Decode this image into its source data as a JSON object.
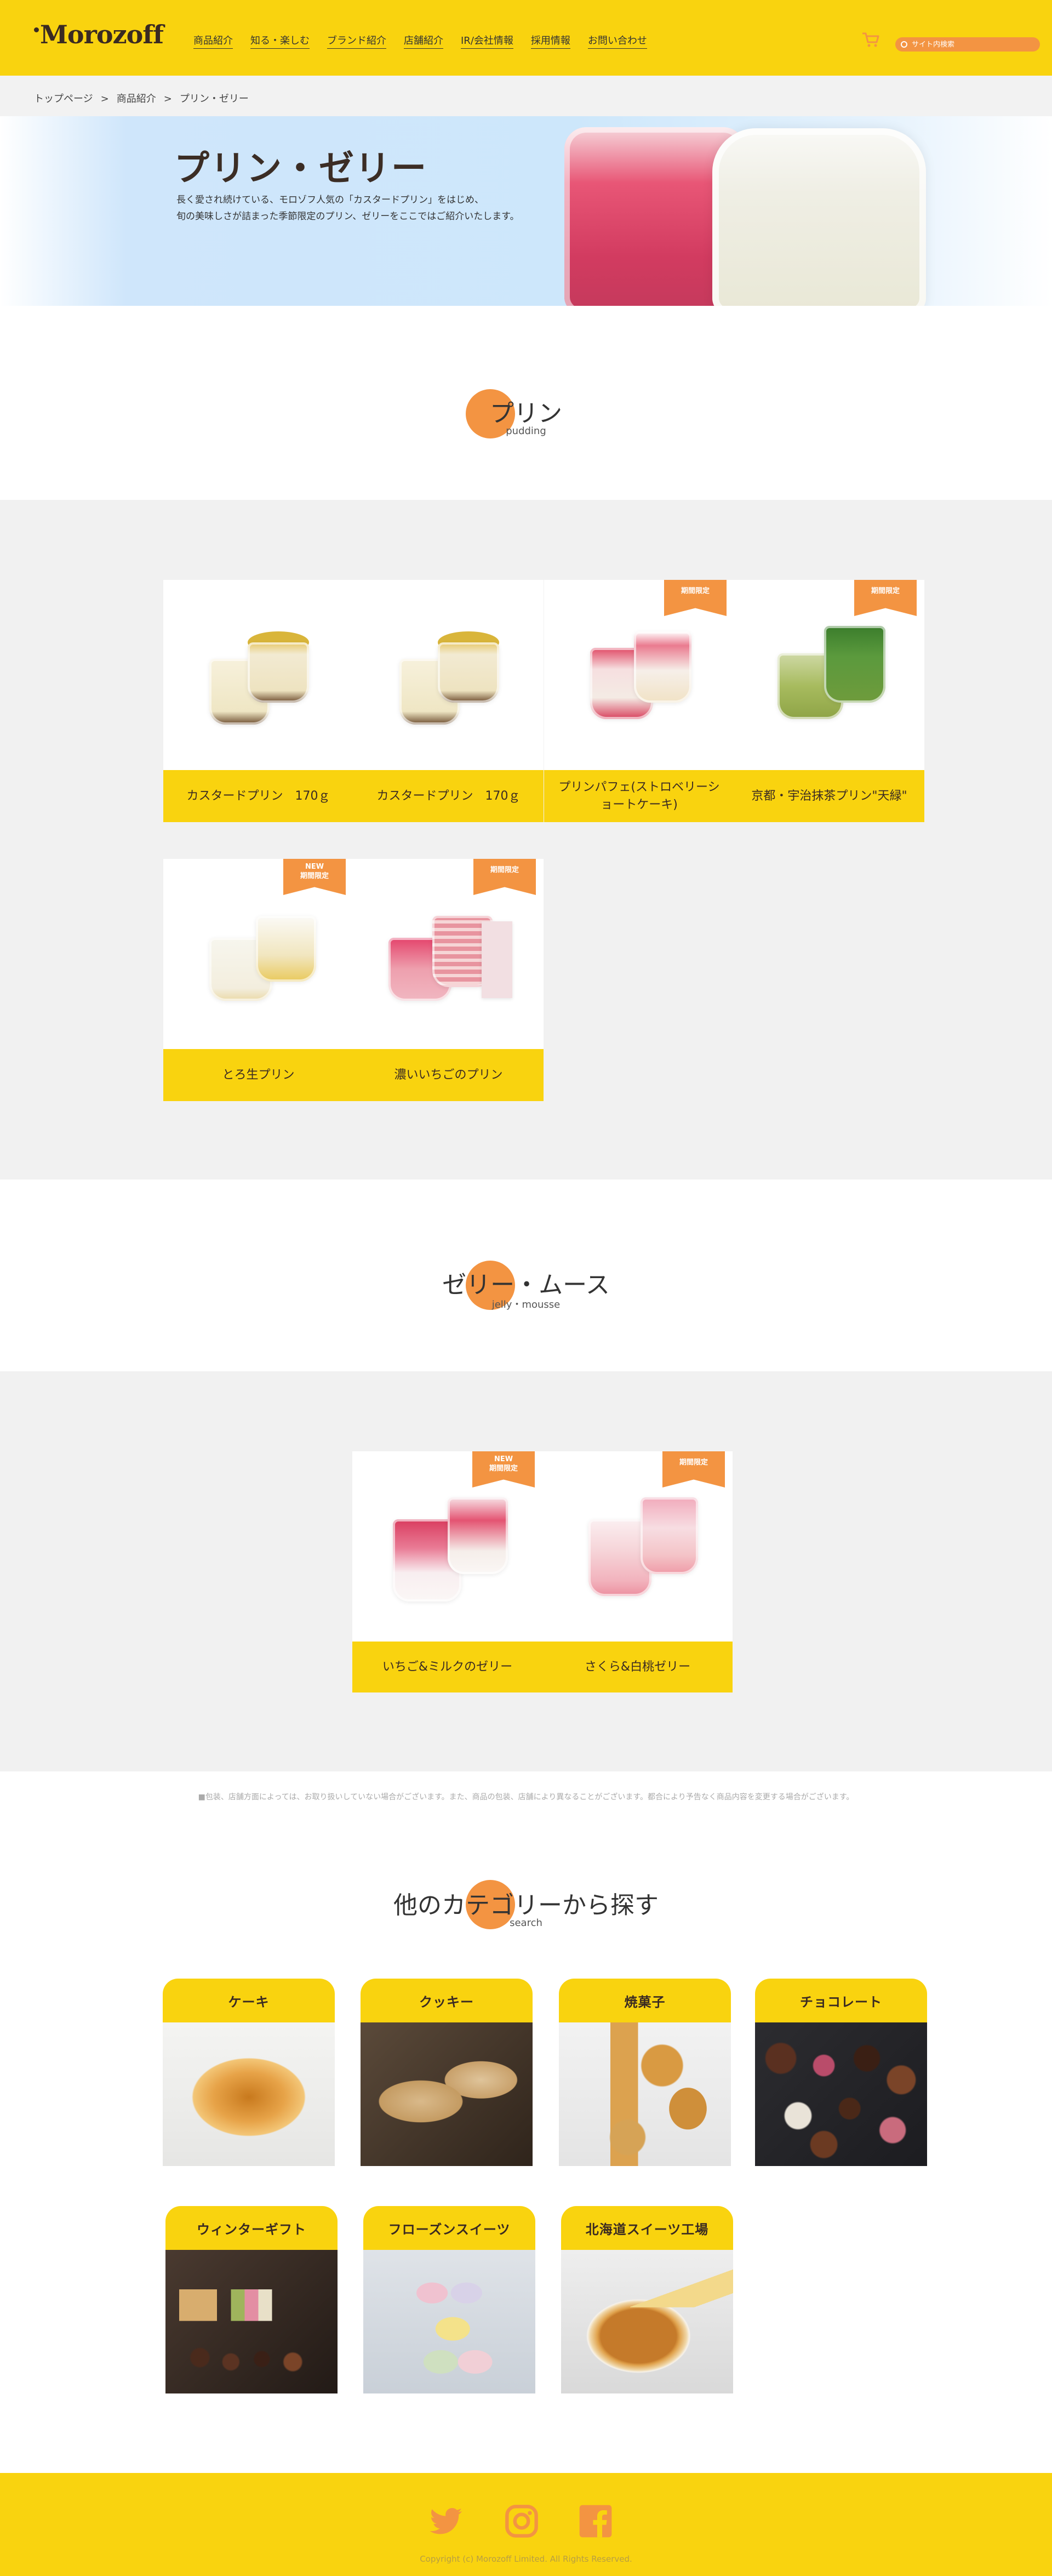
{
  "header": {
    "logo": "Morozoff",
    "nav": [
      "商品紹介",
      "知る・楽しむ",
      "ブランド紹介",
      "店舗紹介",
      "IR/会社情報",
      "採用情報",
      "お問い合わせ"
    ],
    "search_placeholder": "サイト内検索",
    "cart_icon": "cart-icon"
  },
  "breadcrumb": [
    "トップページ",
    "商品紹介",
    "プリン・ゼリー"
  ],
  "hero": {
    "title": "プリン・ゼリー",
    "line1": "長く愛され続けている、モロゾフ人気の「カスタードプリン」をはじめ、",
    "line2": "旬の美味しさが詰まった季節限定のプリン、ゼリーをここではご紹介いたします。"
  },
  "pudding_section": {
    "title": "プリン",
    "subtitle": "pudding",
    "products": [
      {
        "name": "カスタードプリン　170ｇ",
        "badge": ""
      },
      {
        "name": "カスタードプリン　170ｇ",
        "badge": ""
      },
      {
        "name": "プリンパフェ(ストロベリーショートケーキ)",
        "badge": "期間限定"
      },
      {
        "name": "京都・宇治抹茶プリン\"天緑\"",
        "badge": "期間限定"
      },
      {
        "name": "とろ生プリン",
        "badge_new": "NEW",
        "badge": "期間限定"
      },
      {
        "name": "濃いいちごのプリン",
        "badge": "期間限定"
      }
    ]
  },
  "jelly_section": {
    "title": "ゼリー・ムース",
    "subtitle": "jelly・mousse",
    "products": [
      {
        "name": "いちご&ミルクのゼリー",
        "badge_new": "NEW",
        "badge": "期間限定"
      },
      {
        "name": "さくら&白桃ゼリー",
        "badge": "期間限定"
      }
    ]
  },
  "note": "■包装、店舗方面によっては、お取り扱いしていない場合がございます。また、商品の包装、店舗により異なることがございます。都合により予告なく商品内容を変更する場合がございます。",
  "category_section": {
    "title": "他のカテゴリーから探す",
    "subtitle": "search",
    "categories": [
      "ケーキ",
      "クッキー",
      "焼菓子",
      "チョコレート",
      "ウィンターギフト",
      "フローズンスイーツ",
      "北海道スイーツ工場"
    ]
  },
  "footer": {
    "sns": [
      "twitter-icon",
      "instagram-icon",
      "facebook-icon"
    ],
    "copyright": "Copyright (c) Morozoff Limited. All Rights Reserved."
  },
  "colors": {
    "brand_yellow": "#f9d30f",
    "accent_orange": "#f39442",
    "dark_brown": "#3a2a22"
  }
}
